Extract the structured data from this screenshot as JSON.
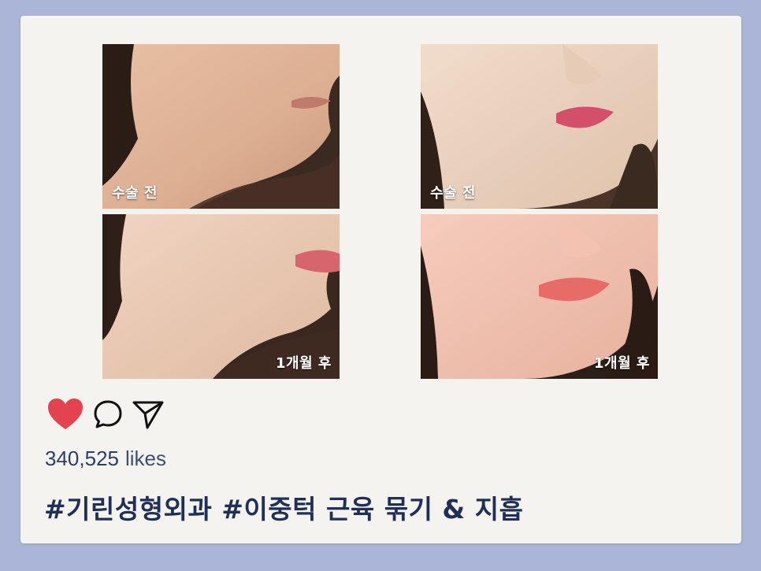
{
  "post": {
    "photos": [
      {
        "label": "수술 전",
        "name": "photo-left-before"
      },
      {
        "label": "수술 전",
        "name": "photo-right-before"
      },
      {
        "label": "1개월 후",
        "name": "photo-left-after"
      },
      {
        "label": "1개월 후",
        "name": "photo-right-after"
      }
    ],
    "actions": {
      "like_icon": "heart-icon",
      "comment_icon": "comment-icon",
      "share_icon": "send-icon",
      "like_color": "#e2434f"
    },
    "likes_count": "340,525",
    "likes_word": "likes",
    "caption": "#기린성형외과 #이중턱 근육 묶기 & 지흡"
  }
}
